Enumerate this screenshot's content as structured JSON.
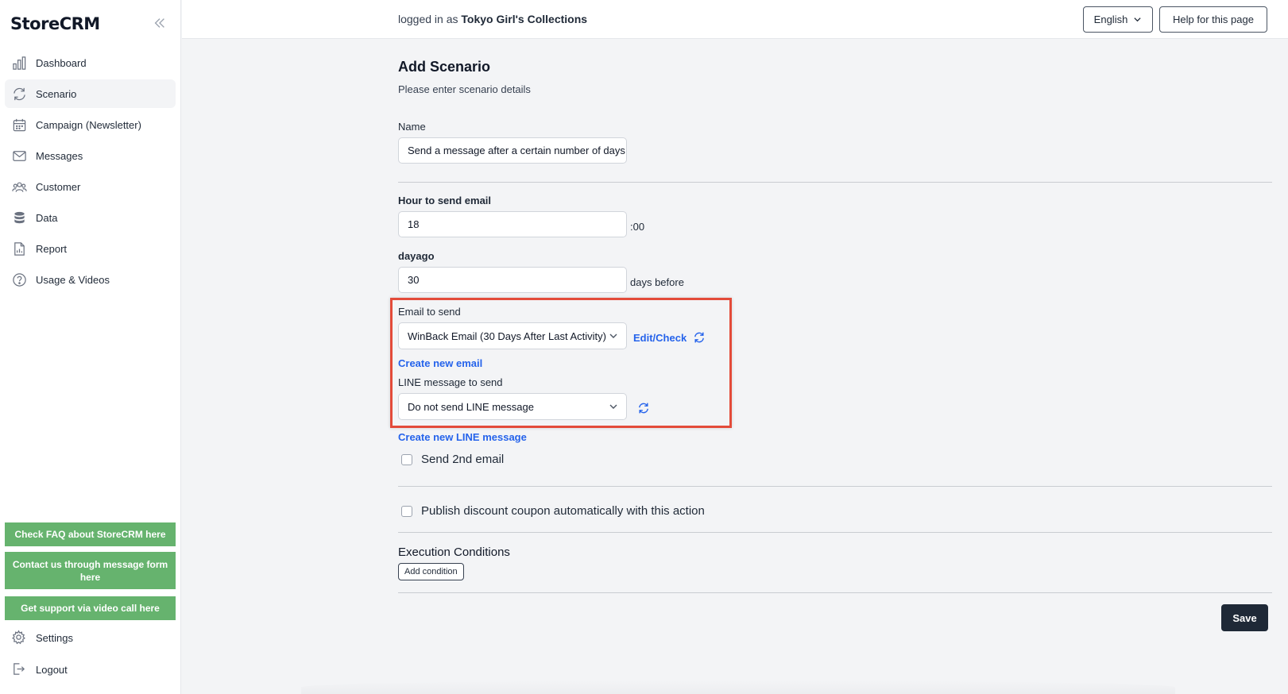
{
  "app": {
    "name": "StoreCRM"
  },
  "sidebar": {
    "items": [
      {
        "label": "Dashboard",
        "icon": "bar-chart-icon"
      },
      {
        "label": "Scenario",
        "icon": "refresh-cycle-icon",
        "active": true
      },
      {
        "label": "Campaign (Newsletter)",
        "icon": "calendar-icon"
      },
      {
        "label": "Messages",
        "icon": "envelope-icon"
      },
      {
        "label": "Customer",
        "icon": "users-icon"
      },
      {
        "label": "Data",
        "icon": "database-icon"
      },
      {
        "label": "Report",
        "icon": "document-chart-icon"
      },
      {
        "label": "Usage & Videos",
        "icon": "question-circle-icon"
      }
    ],
    "support_buttons": {
      "faq": "Check FAQ about StoreCRM here",
      "contact": "Contact us through message form here",
      "video": "Get support via video call here"
    },
    "settings_label": "Settings",
    "logout_label": "Logout"
  },
  "header": {
    "logged_prefix": "logged in as",
    "store_name": "Tokyo Girl's Collections",
    "language": "English",
    "help_label": "Help for this page"
  },
  "form": {
    "title": "Add Scenario",
    "subtitle": "Please enter scenario details",
    "name_label": "Name",
    "name_value": "Send a message after a certain number of days",
    "hour_label": "Hour to send email",
    "hour_value": "18",
    "hour_suffix": ":00",
    "dayago_label": "dayago",
    "dayago_value": "30",
    "dayago_suffix": "days before",
    "email_label": "Email to send",
    "email_value": "WinBack Email (30 Days After Last Activity)",
    "edit_check_label": "Edit/Check",
    "create_email_label": "Create new email",
    "line_label": "LINE message to send",
    "line_value": "Do not send LINE message",
    "create_line_label": "Create new LINE message",
    "second_email_label": "Send 2nd email",
    "second_email_checked": false,
    "coupon_label": "Publish discount coupon automatically with this action",
    "coupon_checked": false,
    "conditions_title": "Execution Conditions",
    "add_condition_label": "Add condition",
    "save_label": "Save"
  },
  "colors": {
    "accent_link": "#2563eb",
    "support_green": "#66b36e",
    "highlight_red": "#e34b3a",
    "save_dark": "#1f2937"
  }
}
